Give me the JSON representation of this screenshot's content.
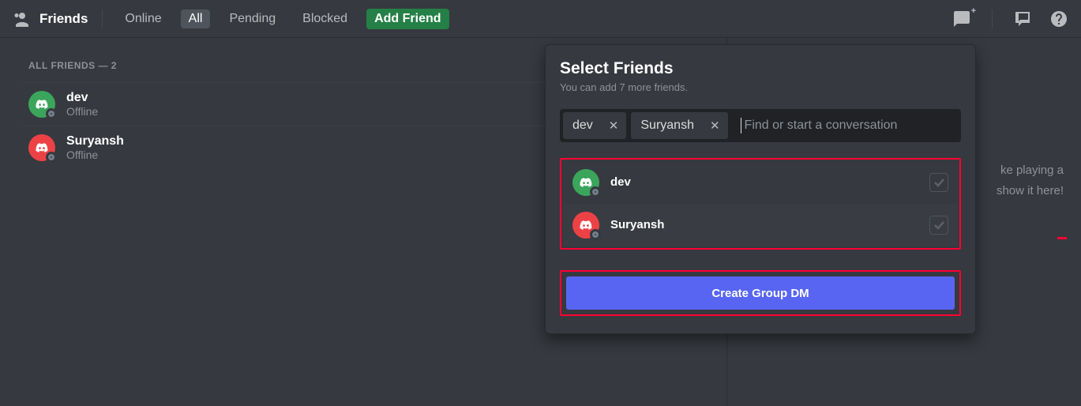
{
  "header": {
    "title": "Friends",
    "tabs": {
      "online": "Online",
      "all": "All",
      "pending": "Pending",
      "blocked": "Blocked"
    },
    "add_friend": "Add Friend"
  },
  "friends_list": {
    "heading": "ALL FRIENDS — 2",
    "items": [
      {
        "name": "dev",
        "status": "Offline",
        "color": "#3ba55c"
      },
      {
        "name": "Suryansh",
        "status": "Offline",
        "color": "#ed4245"
      }
    ]
  },
  "sidebar": {
    "line1": "ke playing a",
    "line2": "show it here!"
  },
  "popover": {
    "title": "Select Friends",
    "subtitle": "You can add 7 more friends.",
    "chips": [
      {
        "label": "dev"
      },
      {
        "label": "Suryansh"
      }
    ],
    "search_placeholder": "Find or start a conversation",
    "options": [
      {
        "name": "dev",
        "color": "#3ba55c"
      },
      {
        "name": "Suryansh",
        "color": "#ed4245"
      }
    ],
    "button": "Create Group DM"
  }
}
